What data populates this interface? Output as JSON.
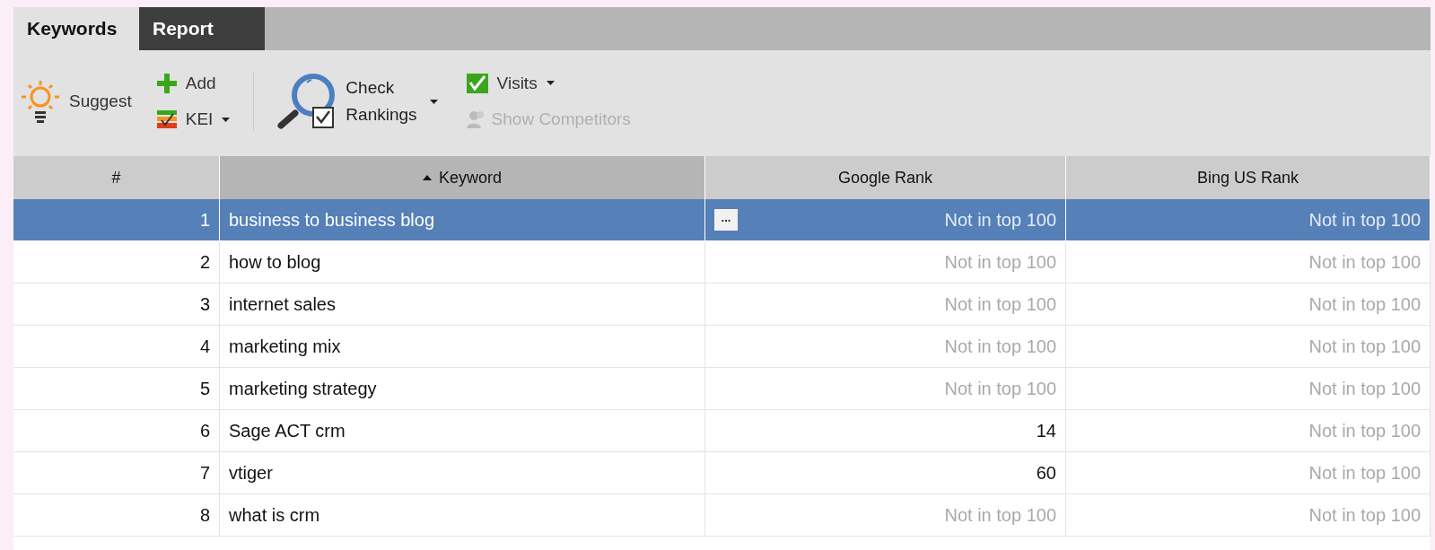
{
  "tabs": [
    {
      "label": "Keywords",
      "selected": true
    },
    {
      "label": "Report",
      "selected": false
    }
  ],
  "toolbar": {
    "suggest": "Suggest",
    "add": "Add",
    "kei": "KEI",
    "check_rankings": [
      "Check",
      "Rankings"
    ],
    "visits": "Visits",
    "show_competitors": {
      "label": "Show Competitors",
      "disabled": true
    }
  },
  "table": {
    "columns": [
      {
        "label": "#",
        "sorted": false
      },
      {
        "label": "Keyword",
        "sorted": true
      },
      {
        "label": "Google Rank",
        "sorted": false
      },
      {
        "label": "Bing US Rank",
        "sorted": false
      }
    ],
    "rows": [
      {
        "num": "1",
        "keyword": "business to business blog",
        "google": {
          "text": "Not in top 100",
          "ranked": false
        },
        "bing": {
          "text": "Not in top 100",
          "ranked": false
        },
        "selected": true,
        "more": "..."
      },
      {
        "num": "2",
        "keyword": "how to blog",
        "google": {
          "text": "Not in top 100",
          "ranked": false
        },
        "bing": {
          "text": "Not in top 100",
          "ranked": false
        },
        "selected": false
      },
      {
        "num": "3",
        "keyword": "internet sales",
        "google": {
          "text": "Not in top 100",
          "ranked": false
        },
        "bing": {
          "text": "Not in top 100",
          "ranked": false
        },
        "selected": false
      },
      {
        "num": "4",
        "keyword": "marketing mix",
        "google": {
          "text": "Not in top 100",
          "ranked": false
        },
        "bing": {
          "text": "Not in top 100",
          "ranked": false
        },
        "selected": false
      },
      {
        "num": "5",
        "keyword": "marketing strategy",
        "google": {
          "text": "Not in top 100",
          "ranked": false
        },
        "bing": {
          "text": "Not in top 100",
          "ranked": false
        },
        "selected": false
      },
      {
        "num": "6",
        "keyword": "Sage ACT crm",
        "google": {
          "text": "14",
          "ranked": true
        },
        "bing": {
          "text": "Not in top 100",
          "ranked": false
        },
        "selected": false
      },
      {
        "num": "7",
        "keyword": "vtiger",
        "google": {
          "text": "60",
          "ranked": true
        },
        "bing": {
          "text": "Not in top 100",
          "ranked": false
        },
        "selected": false
      },
      {
        "num": "8",
        "keyword": "what is crm",
        "google": {
          "text": "Not in top 100",
          "ranked": false
        },
        "bing": {
          "text": "Not in top 100",
          "ranked": false
        },
        "selected": false
      }
    ]
  }
}
